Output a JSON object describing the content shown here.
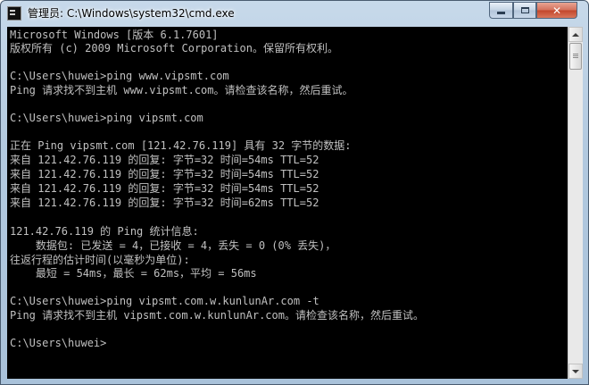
{
  "window": {
    "title": "管理员: C:\\Windows\\system32\\cmd.exe",
    "app_icon": "cmd-icon",
    "controls": {
      "minimize": "minimize-icon",
      "maximize": "maximize-icon",
      "close_glyph": "✕"
    }
  },
  "console": {
    "text_color": "#c0c0c0",
    "background": "#000000",
    "lines": [
      "Microsoft Windows [版本 6.1.7601]",
      "版权所有 (c) 2009 Microsoft Corporation。保留所有权利。",
      "",
      "C:\\Users\\huwei>ping www.vipsmt.com",
      "Ping 请求找不到主机 www.vipsmt.com。请检查该名称，然后重试。",
      "",
      "C:\\Users\\huwei>ping vipsmt.com",
      "",
      "正在 Ping vipsmt.com [121.42.76.119] 具有 32 字节的数据:",
      "来自 121.42.76.119 的回复: 字节=32 时间=54ms TTL=52",
      "来自 121.42.76.119 的回复: 字节=32 时间=54ms TTL=52",
      "来自 121.42.76.119 的回复: 字节=32 时间=54ms TTL=52",
      "来自 121.42.76.119 的回复: 字节=32 时间=62ms TTL=52",
      "",
      "121.42.76.119 的 Ping 统计信息:",
      "    数据包: 已发送 = 4，已接收 = 4，丢失 = 0 (0% 丢失)，",
      "往返行程的估计时间(以毫秒为单位):",
      "    最短 = 54ms，最长 = 62ms，平均 = 56ms",
      "",
      "C:\\Users\\huwei>ping vipsmt.com.w.kunlunAr.com -t",
      "Ping 请求找不到主机 vipsmt.com.w.kunlunAr.com。请检查该名称，然后重试。",
      "",
      "C:\\Users\\huwei>"
    ]
  },
  "scrollbar": {
    "up": "arrow-up-icon",
    "down": "arrow-down-icon"
  }
}
